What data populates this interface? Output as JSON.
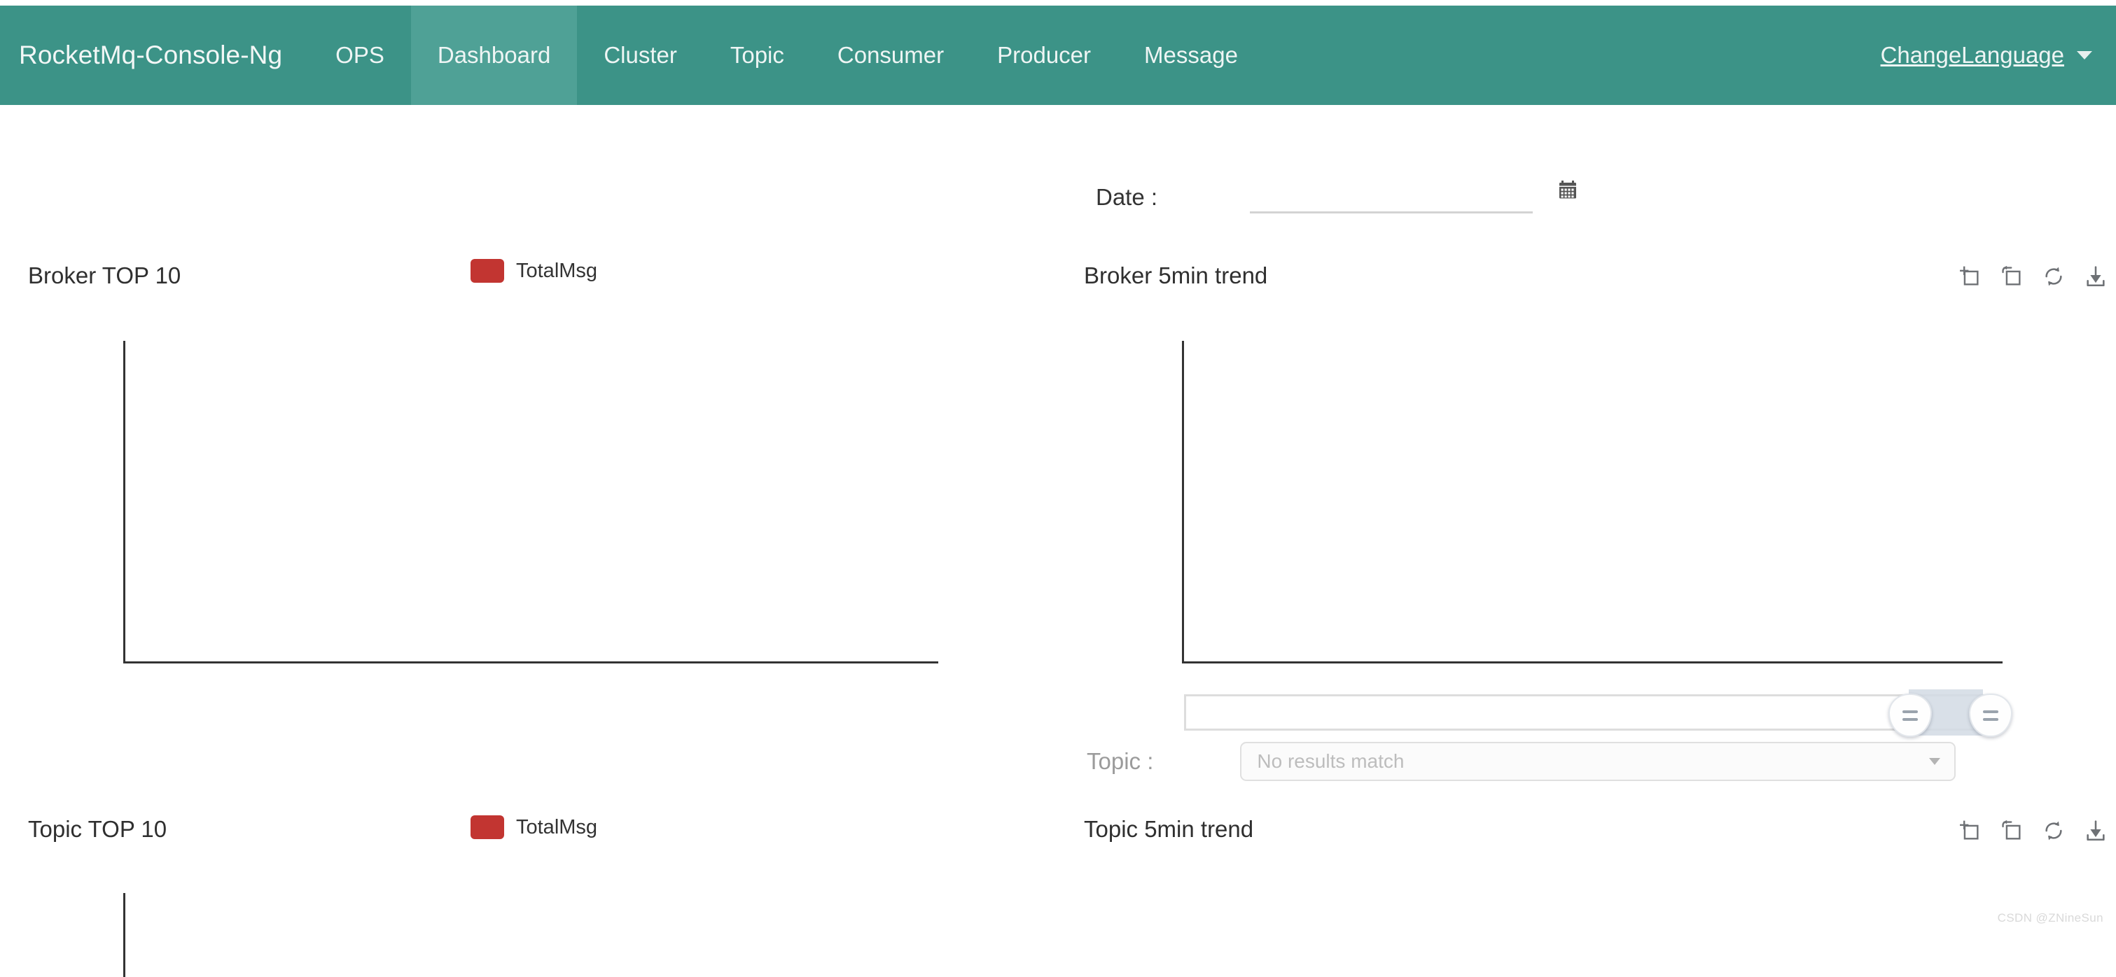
{
  "navbar": {
    "brand": "RocketMq-Console-Ng",
    "items": [
      {
        "label": "OPS",
        "active": false
      },
      {
        "label": "Dashboard",
        "active": true
      },
      {
        "label": "Cluster",
        "active": false
      },
      {
        "label": "Topic",
        "active": false
      },
      {
        "label": "Consumer",
        "active": false
      },
      {
        "label": "Producer",
        "active": false
      },
      {
        "label": "Message",
        "active": false
      }
    ],
    "language_menu": "ChangeLanguage",
    "bg_color": "#3c9387",
    "active_bg_color": "#4fa196"
  },
  "filters": {
    "date_label": "Date :",
    "date_value": "",
    "date_placeholder": "",
    "calendar_icon": "calendar-icon"
  },
  "panels": {
    "broker_top10": {
      "title": "Broker TOP 10",
      "legend": [
        {
          "label": "TotalMsg",
          "color": "#c23531"
        }
      ]
    },
    "broker_trend": {
      "title": "Broker 5min trend",
      "toolbox": [
        {
          "name": "data-zoom-icon",
          "title": "Data Zoom"
        },
        {
          "name": "zoom-restore-icon",
          "title": "Restore Zoom"
        },
        {
          "name": "refresh-icon",
          "title": "Refresh"
        },
        {
          "name": "download-icon",
          "title": "Save As Image"
        }
      ],
      "topic_label": "Topic :",
      "topic_selected": "No results match"
    },
    "topic_top10": {
      "title": "Topic TOP 10",
      "legend": [
        {
          "label": "TotalMsg",
          "color": "#c23531"
        }
      ]
    },
    "topic_trend": {
      "title": "Topic 5min trend",
      "toolbox": [
        {
          "name": "data-zoom-icon",
          "title": "Data Zoom"
        },
        {
          "name": "zoom-restore-icon",
          "title": "Restore Zoom"
        },
        {
          "name": "refresh-icon",
          "title": "Refresh"
        },
        {
          "name": "download-icon",
          "title": "Save As Image"
        }
      ]
    }
  },
  "chart_data": [
    {
      "id": "broker-top10",
      "type": "bar",
      "title": "Broker TOP 10",
      "categories": [],
      "series": [
        {
          "name": "TotalMsg",
          "values": [],
          "color": "#c23531"
        }
      ],
      "xlabel": "",
      "ylabel": "",
      "tick_labels_x": [],
      "tick_labels_y": [],
      "grid": false,
      "legend_position": "top-right",
      "empty": true
    },
    {
      "id": "broker-5min-trend",
      "type": "line",
      "title": "Broker 5min trend",
      "x": [],
      "series": [],
      "xlabel": "",
      "ylabel": "",
      "tick_labels_x": [],
      "tick_labels_y": [],
      "grid": false,
      "legend_position": "none",
      "empty": true
    },
    {
      "id": "topic-top10",
      "type": "bar",
      "title": "Topic TOP 10",
      "categories": [],
      "series": [
        {
          "name": "TotalMsg",
          "values": [],
          "color": "#c23531"
        }
      ],
      "xlabel": "",
      "ylabel": "",
      "tick_labels_x": [],
      "tick_labels_y": [],
      "grid": false,
      "legend_position": "top-right",
      "empty": true
    },
    {
      "id": "topic-5min-trend",
      "type": "line",
      "title": "Topic 5min trend",
      "x": [],
      "series": [],
      "xlabel": "",
      "ylabel": "",
      "tick_labels_x": [],
      "tick_labels_y": [],
      "grid": false,
      "legend_position": "none",
      "empty": true
    }
  ],
  "watermark": "CSDN @ZNineSun"
}
